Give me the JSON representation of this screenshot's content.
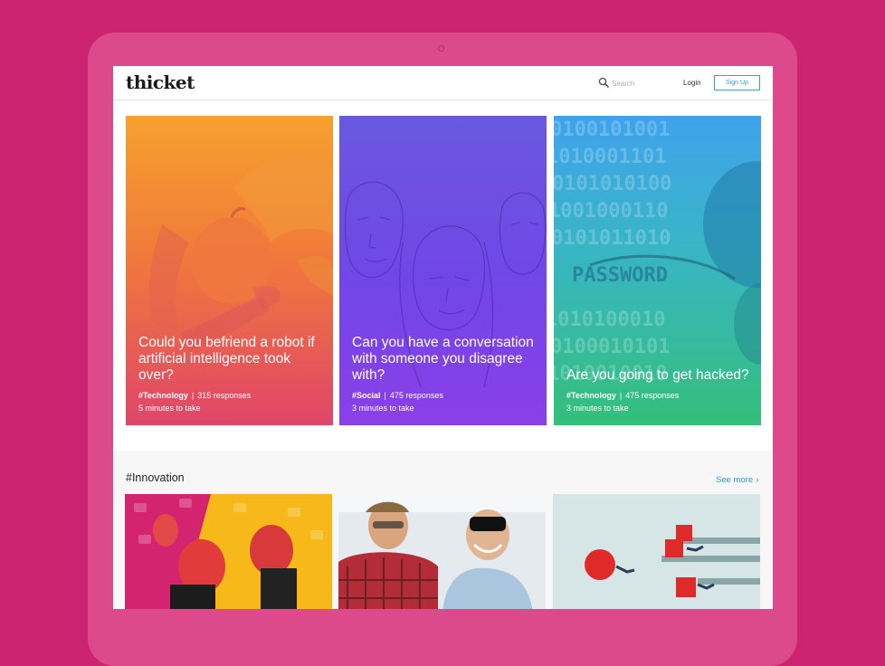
{
  "brand": {
    "logo": "thicket"
  },
  "nav": {
    "search_placeholder": "Search",
    "login_label": "Login",
    "signup_label": "Sign Up"
  },
  "cards": [
    {
      "title": "Could you befriend a robot if artificial intelligence took over?",
      "tag": "#Technology",
      "separator": "|",
      "responses": "315 responses",
      "time": "5 minutes to take"
    },
    {
      "title": "Can you have a conversation with someone you disagree with?",
      "tag": "#Social",
      "separator": "|",
      "responses": "475 responses",
      "time": "3 minutes to take"
    },
    {
      "title": "Are you going to get hacked?",
      "tag": "#Technology",
      "separator": "|",
      "responses": "475 responses",
      "time": "3 minutes to take"
    }
  ],
  "card3_image_text": "PASSWORD",
  "innovation": {
    "title": "#Innovation",
    "see_more_label": "See more",
    "see_more_icon": "chevron-right-icon"
  },
  "colors": {
    "background": "#cc2470",
    "tablet": "#dc4a8b",
    "accent": "#2aa3e0",
    "see_more": "#2a95d8"
  }
}
